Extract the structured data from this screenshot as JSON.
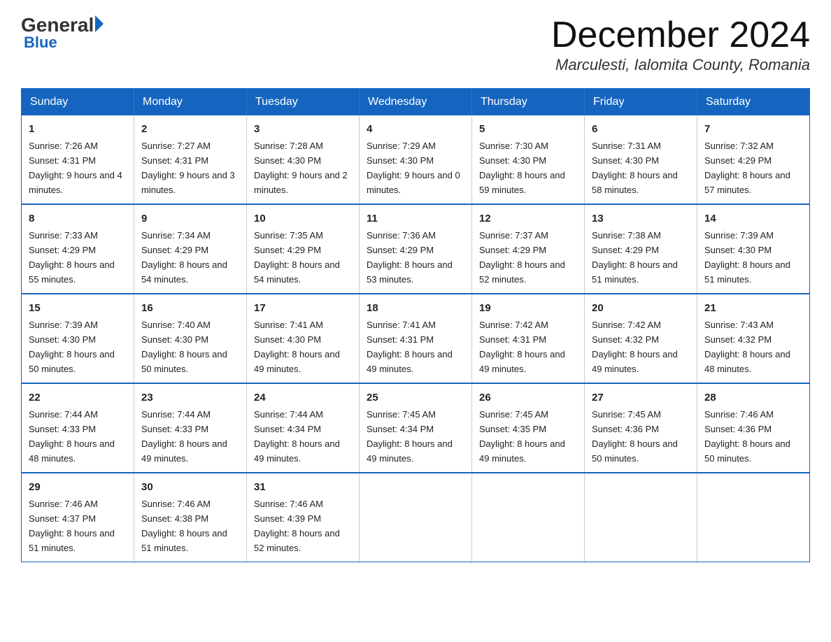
{
  "logo": {
    "general": "General",
    "triangle": "",
    "blue": "Blue"
  },
  "header": {
    "month": "December 2024",
    "location": "Marculesti, Ialomita County, Romania"
  },
  "days_of_week": [
    "Sunday",
    "Monday",
    "Tuesday",
    "Wednesday",
    "Thursday",
    "Friday",
    "Saturday"
  ],
  "weeks": [
    [
      {
        "day": "1",
        "sunrise": "7:26 AM",
        "sunset": "4:31 PM",
        "daylight": "9 hours and 4 minutes."
      },
      {
        "day": "2",
        "sunrise": "7:27 AM",
        "sunset": "4:31 PM",
        "daylight": "9 hours and 3 minutes."
      },
      {
        "day": "3",
        "sunrise": "7:28 AM",
        "sunset": "4:30 PM",
        "daylight": "9 hours and 2 minutes."
      },
      {
        "day": "4",
        "sunrise": "7:29 AM",
        "sunset": "4:30 PM",
        "daylight": "9 hours and 0 minutes."
      },
      {
        "day": "5",
        "sunrise": "7:30 AM",
        "sunset": "4:30 PM",
        "daylight": "8 hours and 59 minutes."
      },
      {
        "day": "6",
        "sunrise": "7:31 AM",
        "sunset": "4:30 PM",
        "daylight": "8 hours and 58 minutes."
      },
      {
        "day": "7",
        "sunrise": "7:32 AM",
        "sunset": "4:29 PM",
        "daylight": "8 hours and 57 minutes."
      }
    ],
    [
      {
        "day": "8",
        "sunrise": "7:33 AM",
        "sunset": "4:29 PM",
        "daylight": "8 hours and 55 minutes."
      },
      {
        "day": "9",
        "sunrise": "7:34 AM",
        "sunset": "4:29 PM",
        "daylight": "8 hours and 54 minutes."
      },
      {
        "day": "10",
        "sunrise": "7:35 AM",
        "sunset": "4:29 PM",
        "daylight": "8 hours and 54 minutes."
      },
      {
        "day": "11",
        "sunrise": "7:36 AM",
        "sunset": "4:29 PM",
        "daylight": "8 hours and 53 minutes."
      },
      {
        "day": "12",
        "sunrise": "7:37 AM",
        "sunset": "4:29 PM",
        "daylight": "8 hours and 52 minutes."
      },
      {
        "day": "13",
        "sunrise": "7:38 AM",
        "sunset": "4:29 PM",
        "daylight": "8 hours and 51 minutes."
      },
      {
        "day": "14",
        "sunrise": "7:39 AM",
        "sunset": "4:30 PM",
        "daylight": "8 hours and 51 minutes."
      }
    ],
    [
      {
        "day": "15",
        "sunrise": "7:39 AM",
        "sunset": "4:30 PM",
        "daylight": "8 hours and 50 minutes."
      },
      {
        "day": "16",
        "sunrise": "7:40 AM",
        "sunset": "4:30 PM",
        "daylight": "8 hours and 50 minutes."
      },
      {
        "day": "17",
        "sunrise": "7:41 AM",
        "sunset": "4:30 PM",
        "daylight": "8 hours and 49 minutes."
      },
      {
        "day": "18",
        "sunrise": "7:41 AM",
        "sunset": "4:31 PM",
        "daylight": "8 hours and 49 minutes."
      },
      {
        "day": "19",
        "sunrise": "7:42 AM",
        "sunset": "4:31 PM",
        "daylight": "8 hours and 49 minutes."
      },
      {
        "day": "20",
        "sunrise": "7:42 AM",
        "sunset": "4:32 PM",
        "daylight": "8 hours and 49 minutes."
      },
      {
        "day": "21",
        "sunrise": "7:43 AM",
        "sunset": "4:32 PM",
        "daylight": "8 hours and 48 minutes."
      }
    ],
    [
      {
        "day": "22",
        "sunrise": "7:44 AM",
        "sunset": "4:33 PM",
        "daylight": "8 hours and 48 minutes."
      },
      {
        "day": "23",
        "sunrise": "7:44 AM",
        "sunset": "4:33 PM",
        "daylight": "8 hours and 49 minutes."
      },
      {
        "day": "24",
        "sunrise": "7:44 AM",
        "sunset": "4:34 PM",
        "daylight": "8 hours and 49 minutes."
      },
      {
        "day": "25",
        "sunrise": "7:45 AM",
        "sunset": "4:34 PM",
        "daylight": "8 hours and 49 minutes."
      },
      {
        "day": "26",
        "sunrise": "7:45 AM",
        "sunset": "4:35 PM",
        "daylight": "8 hours and 49 minutes."
      },
      {
        "day": "27",
        "sunrise": "7:45 AM",
        "sunset": "4:36 PM",
        "daylight": "8 hours and 50 minutes."
      },
      {
        "day": "28",
        "sunrise": "7:46 AM",
        "sunset": "4:36 PM",
        "daylight": "8 hours and 50 minutes."
      }
    ],
    [
      {
        "day": "29",
        "sunrise": "7:46 AM",
        "sunset": "4:37 PM",
        "daylight": "8 hours and 51 minutes."
      },
      {
        "day": "30",
        "sunrise": "7:46 AM",
        "sunset": "4:38 PM",
        "daylight": "8 hours and 51 minutes."
      },
      {
        "day": "31",
        "sunrise": "7:46 AM",
        "sunset": "4:39 PM",
        "daylight": "8 hours and 52 minutes."
      },
      null,
      null,
      null,
      null
    ]
  ],
  "labels": {
    "sunrise_prefix": "Sunrise: ",
    "sunset_prefix": "Sunset: ",
    "daylight_prefix": "Daylight: "
  }
}
